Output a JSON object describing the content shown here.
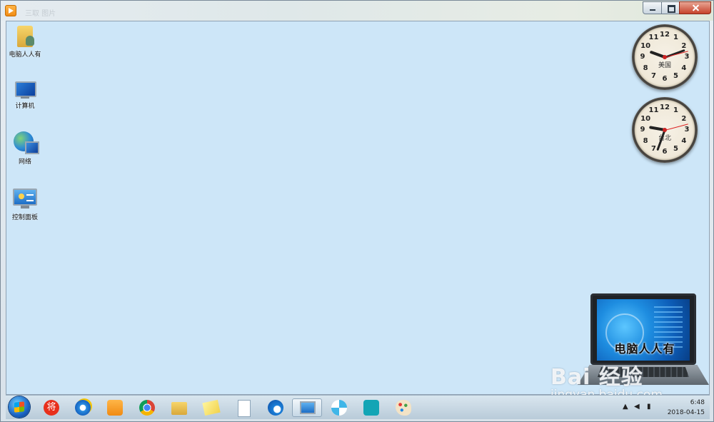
{
  "titlebar": {
    "faded_text": "三取 图片"
  },
  "desktop": {
    "icons": [
      {
        "label": "电脑人人有"
      },
      {
        "label": "计算机"
      },
      {
        "label": "网络"
      },
      {
        "label": "控制面板"
      }
    ]
  },
  "clocks": [
    {
      "city": "美国"
    },
    {
      "city": "台北"
    }
  ],
  "clock_numbers": [
    "12",
    "1",
    "2",
    "3",
    "4",
    "5",
    "6",
    "7",
    "8",
    "9",
    "10",
    "11"
  ],
  "laptop_brand": "电脑人人有",
  "watermark": {
    "brand": "Bai 经验",
    "url": "jingyan.baidu.com"
  },
  "taskbar": {
    "pinned": [
      {
        "name": "jiang-app-icon"
      },
      {
        "name": "internet-explorer-icon"
      },
      {
        "name": "media-player-icon"
      },
      {
        "name": "chrome-icon"
      },
      {
        "name": "file-explorer-icon"
      },
      {
        "name": "sticky-notes-icon"
      },
      {
        "name": "document-icon"
      },
      {
        "name": "edge-icon"
      },
      {
        "name": "control-panel-icon"
      },
      {
        "name": "pinwheel-icon"
      },
      {
        "name": "headset-icon"
      },
      {
        "name": "paint-icon"
      }
    ],
    "tray": {
      "time": "6:48",
      "date": "2018-04-15"
    }
  },
  "colors": {
    "desktop_bg": "#cde6f8",
    "accent": "#1b64c4"
  }
}
